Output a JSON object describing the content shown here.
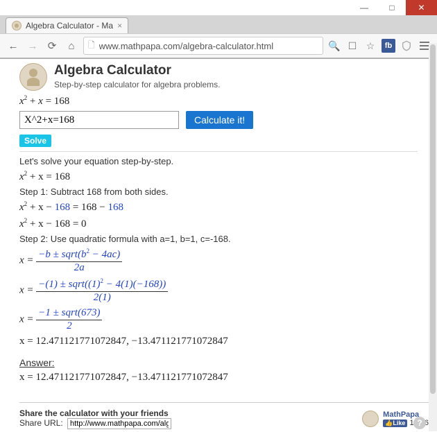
{
  "chrome": {
    "tab_title": "Algebra Calculator - Ma",
    "url": "www.mathpapa.com/algebra-calculator.html"
  },
  "header": {
    "title": "Algebra Calculator",
    "subtitle": "Step-by-step calculator for algebra problems."
  },
  "equation": {
    "display_var": "x",
    "display_plus": " + ",
    "display_plus2": "x",
    "display_eq": " = 168",
    "input_value": "X^2+x=168",
    "calculate_label": "Calculate it!",
    "solve_label": "Solve"
  },
  "steps": {
    "intro": "Let's solve your equation step-by-step.",
    "eq1_a": "x",
    "eq1_b": " + x = 168",
    "step1_label": "Step 1: Subtract 168 from both sides.",
    "eq2_a": "x",
    "eq2_b": " + x − ",
    "eq2_168a": "168",
    "eq2_c": " = 168 − ",
    "eq2_168b": "168",
    "eq3_a": "x",
    "eq3_b": " + x − 168 = 0",
    "step2_label": "Step 2: Use quadratic formula with a=1, b=1, c=-168.",
    "qf_top": "−b ± sqrt(b",
    "qf_top2": " − 4ac)",
    "qf_bot": "2a",
    "qf2_top": "−(1) ± sqrt((1)",
    "qf2_top2": " − 4(1)(−168))",
    "qf2_bot": "2(1)",
    "qf3_top": "−1 ± sqrt(673)",
    "qf3_bot": "2",
    "result": "x = 12.471121771072847,  −13.471121771072847",
    "answer_label": "Answer:",
    "answer": "x = 12.471121771072847,  −13.471121771072847"
  },
  "footer": {
    "share_heading": "Share the calculator with your friends",
    "share_label": "Share URL:",
    "share_url": "http://www.mathpapa.com/alg",
    "brand": "MathPapa",
    "like_label": "Like",
    "like_count": "1,456"
  }
}
